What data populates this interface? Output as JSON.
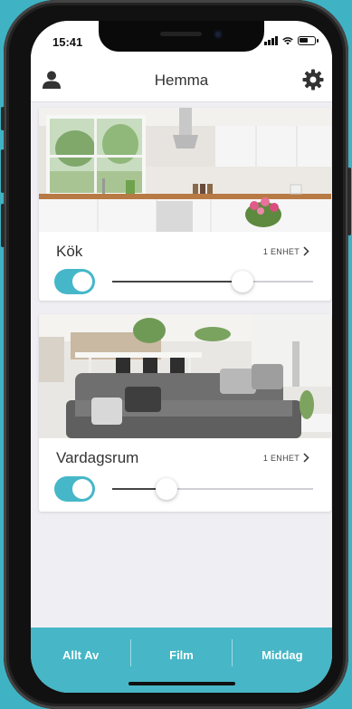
{
  "status_bar": {
    "time": "15:41"
  },
  "header": {
    "title": "Hemma"
  },
  "rooms": [
    {
      "name": "Kök",
      "device_count": "1 ENHET",
      "power_on": true,
      "brightness_fraction": 0.65
    },
    {
      "name": "Vardagsrum",
      "device_count": "1 ENHET",
      "power_on": true,
      "brightness_fraction": 0.27
    }
  ],
  "scenes": [
    {
      "label": "Allt Av"
    },
    {
      "label": "Film"
    },
    {
      "label": "Middag"
    }
  ],
  "colors": {
    "accent": "#46b7c8",
    "background": "#3fb3c4"
  }
}
